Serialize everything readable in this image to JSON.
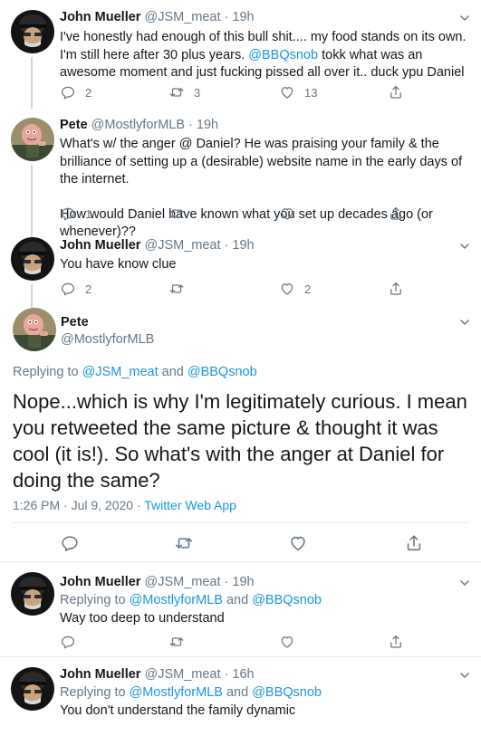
{
  "tweets": [
    {
      "name": "John Mueller",
      "handle": "@JSM_meat",
      "time": "19h",
      "text_pre": "I've honestly had enough of this bull shit.... my food stands on its own. I'm still here after 30 plus years. ",
      "text_mention": "@BBQsnob",
      "text_post": " tokk what was an awesome moment and just fucking pissed all over it.. duck ypu Daniel",
      "reply_count": "2",
      "retweet_count": "3",
      "like_count": "13"
    },
    {
      "name": "Pete",
      "handle": "@MostlyforMLB",
      "time": "19h",
      "text": "What's w/ the anger @ Daniel?  He was praising your family & the brilliance of setting up a (desirable) website name in the early days of the internet.",
      "text2": "How would Daniel have known what you set up decades ago (or whenever)??",
      "reply_count": "1"
    },
    {
      "name": "John Mueller",
      "handle": "@JSM_meat",
      "time": "19h",
      "text": "You have know clue",
      "reply_count": "2",
      "like_count": "2"
    }
  ],
  "focused": {
    "name": "Pete",
    "handle": "@MostlyforMLB",
    "replying_label": "Replying to ",
    "replying_user1": "@JSM_meat",
    "replying_and": " and ",
    "replying_user2": "@BBQsnob",
    "text": "Nope...which is why I'm legitimately curious. I mean you retweeted the same picture & thought it was cool (it is!). So what's with the anger at Daniel for doing the same?",
    "timestamp": "1:26 PM · Jul 9, 2020 · ",
    "source": "Twitter Web App"
  },
  "replies": [
    {
      "name": "John Mueller",
      "handle": "@JSM_meat",
      "time": "19h",
      "replying_label": "Replying to ",
      "replying_user1": "@MostlyforMLB",
      "replying_and": " and ",
      "replying_user2": "@BBQsnob",
      "text": "Way too deep to understand"
    },
    {
      "name": "John Mueller",
      "handle": "@JSM_meat",
      "time": "16h",
      "replying_label": "Replying to ",
      "replying_user1": "@MostlyforMLB",
      "replying_and": " and ",
      "replying_user2": "@BBQsnob",
      "text": "You don't understand the family dynamic"
    }
  ],
  "sep": " · ",
  "colors": {
    "link": "#1b95e0",
    "muted": "#657786",
    "divider": "#e6ecf0",
    "thread": "#ccd6dd"
  },
  "icons": [
    "reply-icon",
    "retweet-icon",
    "like-icon",
    "share-icon",
    "chevron-down-icon"
  ]
}
